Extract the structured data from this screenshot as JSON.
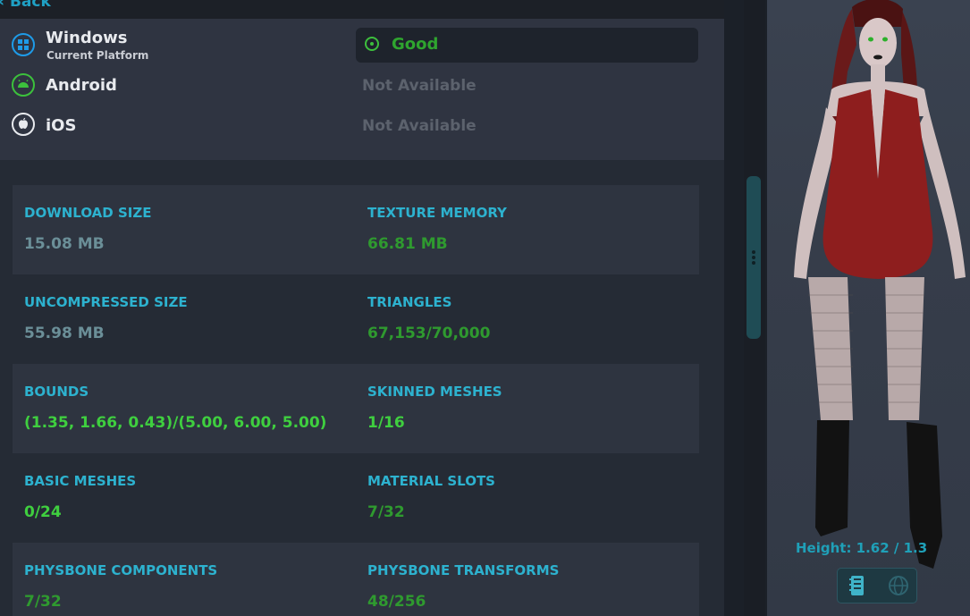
{
  "back_label": "Back",
  "platforms": [
    {
      "name": "Windows",
      "subtitle": "Current Platform",
      "status": "Good",
      "icon": "windows-icon"
    },
    {
      "name": "Android",
      "subtitle": "",
      "status": "Not Available",
      "icon": "android-icon"
    },
    {
      "name": "iOS",
      "subtitle": "",
      "status": "Not Available",
      "icon": "apple-icon"
    }
  ],
  "stats": [
    {
      "label": "DOWNLOAD SIZE",
      "value": "15.08 MB",
      "color": "#6b8f98"
    },
    {
      "label": "TEXTURE MEMORY",
      "value": "66.81 MB",
      "color": "#2f9a2f"
    },
    {
      "label": "UNCOMPRESSED SIZE",
      "value": "55.98 MB",
      "color": "#6b8f98"
    },
    {
      "label": "TRIANGLES",
      "value": "67,153/70,000",
      "color": "#2f9a2f"
    },
    {
      "label": "BOUNDS",
      "value": "(1.35, 1.66, 0.43)/(5.00, 6.00, 5.00)",
      "color": "#3fcf3f"
    },
    {
      "label": "SKINNED MESHES",
      "value": "1/16",
      "color": "#3fcf3f"
    },
    {
      "label": "BASIC MESHES",
      "value": "0/24",
      "color": "#3fcf3f"
    },
    {
      "label": "MATERIAL SLOTS",
      "value": "7/32",
      "color": "#2f9a2f"
    },
    {
      "label": "PHYSBONE COMPONENTS",
      "value": "7/32",
      "color": "#2f9a2f"
    },
    {
      "label": "PHYSBONE TRANSFORMS",
      "value": "48/256",
      "color": "#2f9a2f"
    }
  ],
  "preview": {
    "height_text": "Height: 1.62 / 1.3"
  },
  "colors": {
    "accent": "#2db2cf",
    "good": "#3dbf3d"
  }
}
